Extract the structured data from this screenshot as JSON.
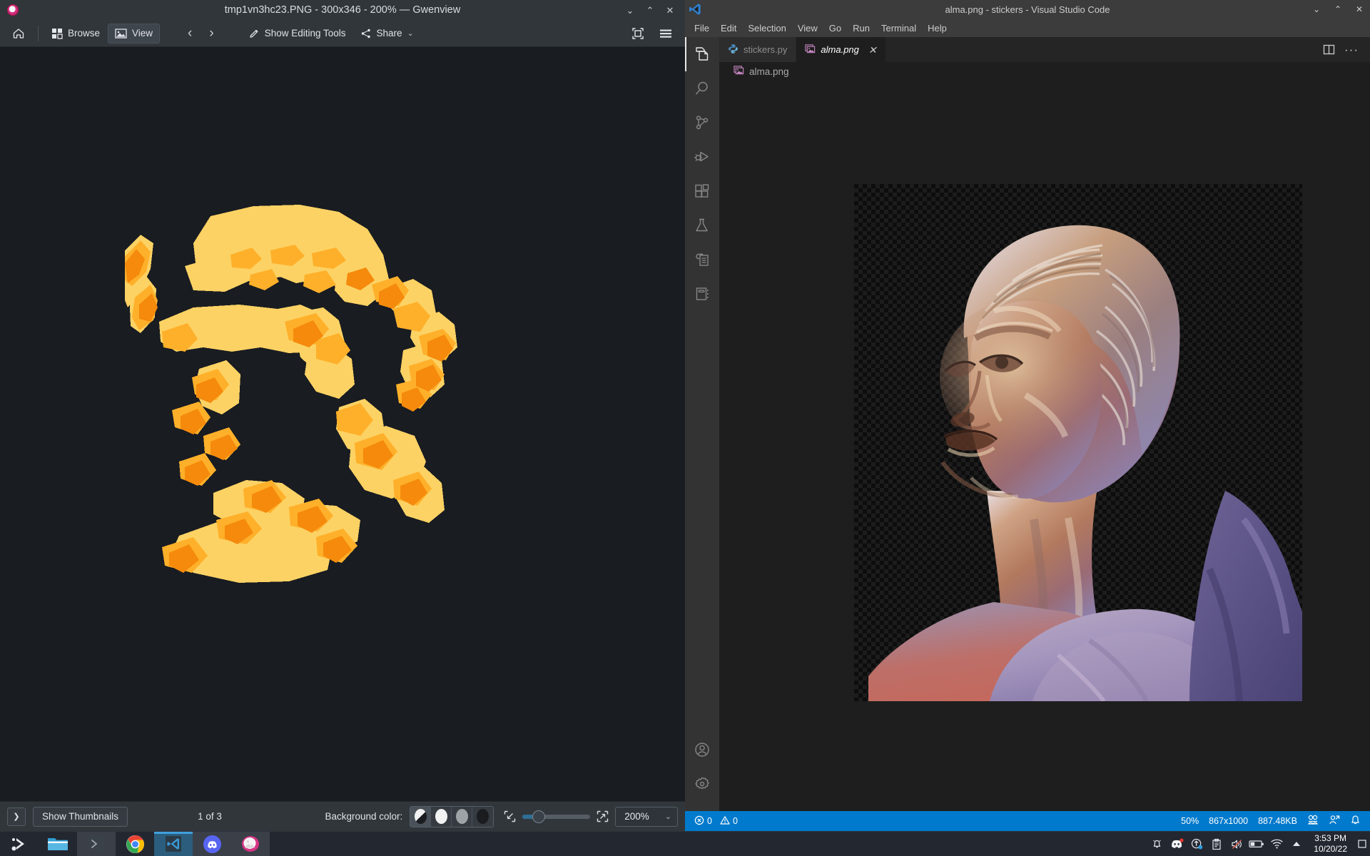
{
  "gwenview": {
    "window_title": "tmp1vn3hc23.PNG - 300x346 - 200% — Gwenview",
    "app_icon_name": "gwenview-icon",
    "window_buttons": [
      {
        "name": "minimize-button",
        "glyph": "⌄"
      },
      {
        "name": "maximize-button",
        "glyph": "⌃"
      },
      {
        "name": "close-button",
        "glyph": "✕"
      }
    ],
    "toolbar": {
      "home_label": "",
      "browse_label": "Browse",
      "view_label": "View",
      "prev_label": "‹",
      "next_label": "›",
      "editing_tools_label": "Show Editing Tools",
      "share_label": "Share",
      "share_caret": "⌄",
      "fullscreen_name": "fullscreen-icon",
      "hamburger_name": "menu-icon"
    },
    "statusbar": {
      "sidebar_toggle_glyph": "❯",
      "thumbnails_label": "Show Thumbnails",
      "page_info": "1 of 3",
      "background_color_label": "Background color:",
      "swatches": [
        {
          "name": "bg-swatch-checker",
          "color": "checker"
        },
        {
          "name": "bg-swatch-white",
          "color": "#f2f2f2"
        },
        {
          "name": "bg-swatch-gray",
          "color": "#9ea3a8"
        },
        {
          "name": "bg-swatch-black",
          "color": "#1a1c20"
        }
      ],
      "fit_icon_name": "zoom-fit-icon",
      "actual_size_icon_name": "zoom-actual-size-icon",
      "zoom_value": "200%",
      "zoom_caret": "⌄"
    },
    "image": {
      "description": "Posterized yellow-orange silhouette of a classical statue head on dark background",
      "palette": {
        "background": "#191c21",
        "light": "#fcd264",
        "mid": "#ffb02a",
        "dark": "#f58a0c"
      }
    }
  },
  "vscode": {
    "window_title": "alma.png - stickers - Visual Studio Code",
    "window_buttons": [
      {
        "name": "minimize-button",
        "glyph": "⌄"
      },
      {
        "name": "maximize-button",
        "glyph": "⌃"
      },
      {
        "name": "close-button",
        "glyph": "✕"
      }
    ],
    "menu_items": [
      "File",
      "Edit",
      "Selection",
      "View",
      "Go",
      "Run",
      "Terminal",
      "Help"
    ],
    "activity_bar": [
      {
        "name": "explorer-icon",
        "label": "Explorer",
        "active": true
      },
      {
        "name": "search-icon",
        "label": "Search",
        "active": false
      },
      {
        "name": "source-control-icon",
        "label": "Source Control",
        "active": false
      },
      {
        "name": "run-and-debug-icon",
        "label": "Run and Debug",
        "active": false
      },
      {
        "name": "extensions-icon",
        "label": "Extensions",
        "active": false
      },
      {
        "name": "testing-flask-icon",
        "label": "Testing",
        "active": false
      },
      {
        "name": "remote-explorer-icon",
        "label": "Remote Explorer",
        "active": false
      },
      {
        "name": "notebook-icon",
        "label": "Notebook",
        "active": false
      }
    ],
    "activity_bar_bottom": [
      {
        "name": "account-icon",
        "label": "Accounts"
      },
      {
        "name": "settings-gear-icon",
        "label": "Manage"
      }
    ],
    "tabs": [
      {
        "name": "tab-stickers-py",
        "label": "stickers.py",
        "icon": "python-file-icon",
        "active": false,
        "closable": false
      },
      {
        "name": "tab-alma-png",
        "label": "alma.png",
        "icon": "image-file-icon",
        "active": true,
        "closable": true,
        "close_glyph": "✕"
      }
    ],
    "tab_actions": [
      {
        "name": "split-editor-icon",
        "label": "Split Editor"
      },
      {
        "name": "more-actions-icon",
        "label": "More Actions...",
        "glyph": "···"
      }
    ],
    "breadcrumb": {
      "icon": "image-file-icon",
      "label": "alma.png"
    },
    "status_bar": {
      "errors_icon": "error-circle-icon",
      "errors": "0",
      "warnings_icon": "warning-triangle-icon",
      "warnings": "0",
      "zoom": "50%",
      "dimensions": "867x1000",
      "size": "887.48KB",
      "live_share_icon": "live-share-icon",
      "remote_icon": "remote-window-icon",
      "bell_icon": "bell-icon",
      "accent_color": "#007acc"
    },
    "preview": {
      "description": "Classical marble statue head of a woman, duotone gold and violet, on transparent checkerboard"
    }
  },
  "taskbar": {
    "items": [
      {
        "name": "taskbar-start-button",
        "label": "Start",
        "state": "none"
      },
      {
        "name": "taskbar-file-explorer",
        "label": "File Explorer",
        "state": "none"
      },
      {
        "name": "taskbar-terminal",
        "label": "Terminal",
        "state": "open"
      },
      {
        "name": "taskbar-chrome",
        "label": "Google Chrome",
        "state": "none"
      },
      {
        "name": "taskbar-vscode",
        "label": "Visual Studio Code",
        "state": "active"
      },
      {
        "name": "taskbar-discord",
        "label": "Discord",
        "state": "open"
      },
      {
        "name": "taskbar-gwenview",
        "label": "Gwenview",
        "state": "open"
      }
    ],
    "tray": [
      {
        "name": "notification-bell-icon",
        "label": "Notifications"
      },
      {
        "name": "discord-tray-icon",
        "label": "Discord",
        "badge": true
      },
      {
        "name": "update-arrow-icon",
        "label": "Updates"
      },
      {
        "name": "clipboard-icon",
        "label": "Clipboard"
      },
      {
        "name": "volume-muted-icon",
        "label": "Volume muted"
      },
      {
        "name": "battery-icon",
        "label": "Battery"
      },
      {
        "name": "wifi-icon",
        "label": "Network"
      },
      {
        "name": "show-hidden-icons-icon",
        "label": "Show hidden icons",
        "glyph": "▲"
      }
    ],
    "clock": {
      "time": "3:53 PM",
      "date": "10/20/22"
    },
    "show_desktop_name": "show-desktop-button"
  }
}
